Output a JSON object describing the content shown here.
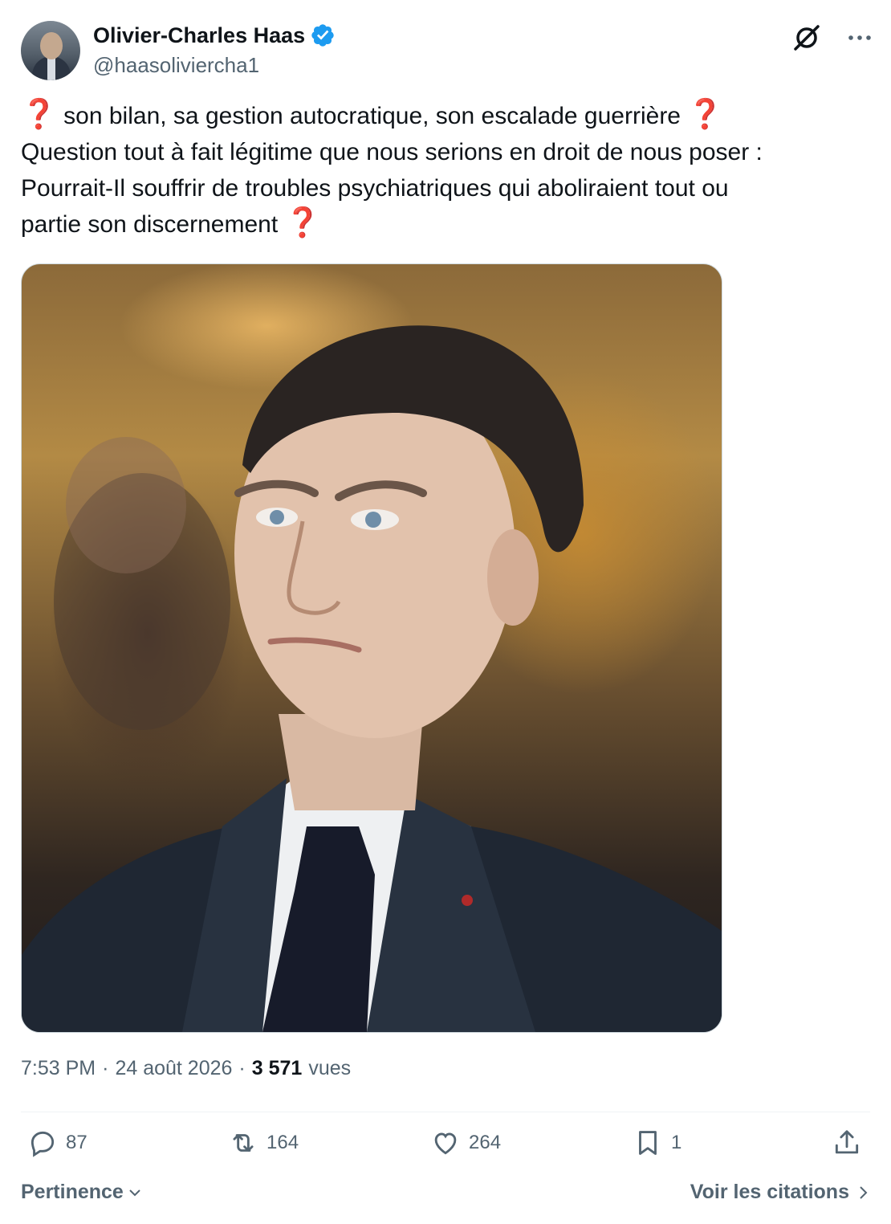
{
  "author": {
    "name": "Olivier-Charles Haas",
    "handle": "@haasolivierchа1"
  },
  "tweet": {
    "line1": "son bilan, sa gestion autocratique, son escalade guerrière",
    "line2": "Question tout à fait légitime que nous serions en droit de nous poser :",
    "line3": "Pourrait-Il souffrir de troubles psychiatriques qui aboliraient tout ou",
    "line4": "partie son discernement",
    "question_mark": "❓"
  },
  "meta": {
    "time": "7:53 PM",
    "sep": "·",
    "date": "24 août 2026",
    "views_count": "3 571",
    "views_label": "vues"
  },
  "actions": {
    "replies": "87",
    "reposts": "164",
    "likes": "264",
    "bookmarks": "1"
  },
  "footer": {
    "sort_label": "Pertinence",
    "quotes_label": "Voir les citations"
  },
  "colors": {
    "verified": "#1d9bf0",
    "secondary_text": "#536471",
    "question_mark": "#c8102e"
  }
}
